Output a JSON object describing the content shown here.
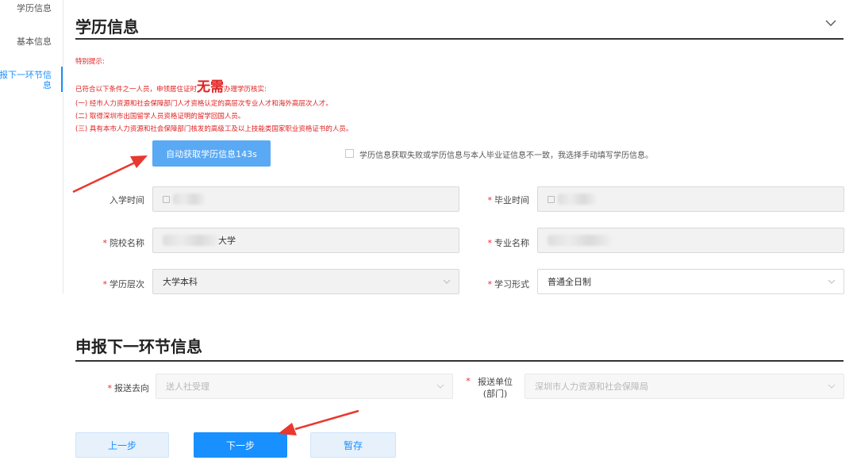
{
  "sidebar": {
    "items": [
      {
        "label": "学历信息"
      },
      {
        "label": "基本信息"
      },
      {
        "label": "报下一环节信息"
      }
    ]
  },
  "edu": {
    "title": "学历信息",
    "notice_heading": "特别提示:",
    "notice_intro_before": "已符合以下条件之一人员，申领居住证时",
    "notice_emphasis": "无需",
    "notice_intro_after": "办理学历核实:",
    "notice_items": [
      "(一) 经市人力资源和社会保障部门人才资格认定的高层次专业人才和海外高层次人才。",
      "(二) 取得深圳市出国留学人员资格证明的留学回国人员。",
      "(三) 具有本市人力资源和社会保障部门核发的高级工及以上技能类国家职业资格证书的人员。"
    ],
    "auto_button": "自动获取学历信息143s",
    "manual_checkbox_label": "学历信息获取失败或学历信息与本人毕业证信息不一致，我选择手动填写学历信息。",
    "fields": {
      "enroll_label": "入学时间",
      "graduate_label": "毕业时间",
      "school_label": "院校名称",
      "school_value_suffix": "大学",
      "major_label": "专业名称",
      "level_label": "学历层次",
      "level_value": "大学本科",
      "study_mode_label": "学习形式",
      "study_mode_value": "普通全日制"
    }
  },
  "next": {
    "title": "申报下一环节信息",
    "send_to_label": "报送去向",
    "send_to_value": "送人社受理",
    "send_unit_label_1": "报送单位",
    "send_unit_label_2": "(部门)",
    "send_unit_value": "深圳市人力资源和社会保障局"
  },
  "actions": {
    "prev": "上一步",
    "next": "下一步",
    "save": "暂存"
  },
  "colors": {
    "primary": "#1890ff",
    "notice_red": "#e02020",
    "annotation_arrow": "#e8382f"
  }
}
